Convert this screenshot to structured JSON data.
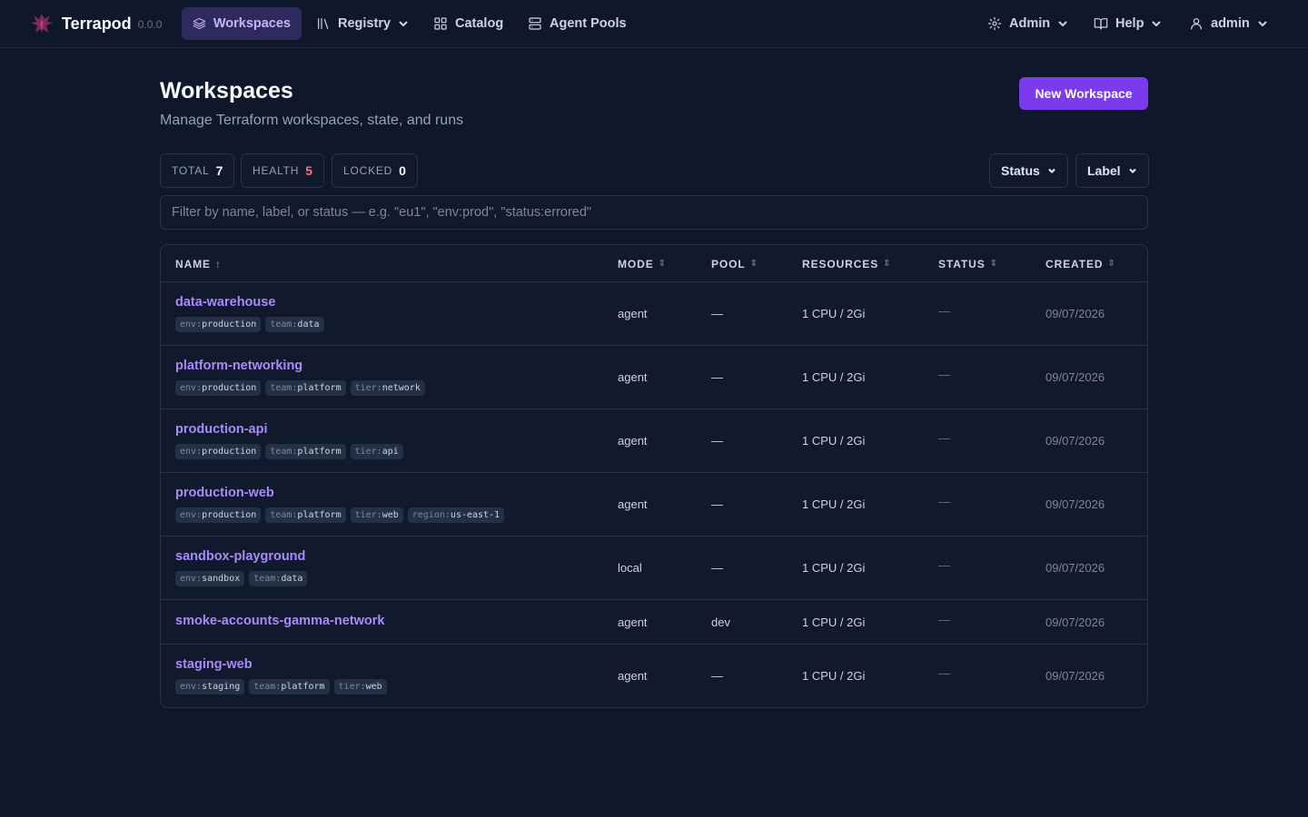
{
  "brand": {
    "name": "Terrapod",
    "version": "0.0.0"
  },
  "nav": {
    "workspaces": "Workspaces",
    "registry": "Registry",
    "catalog": "Catalog",
    "agent_pools": "Agent Pools",
    "admin": "Admin",
    "help": "Help",
    "user": "admin"
  },
  "header": {
    "title": "Workspaces",
    "subtitle": "Manage Terraform workspaces, state, and runs",
    "new_button": "New Workspace"
  },
  "stats": {
    "total_label": "TOTAL",
    "total_value": "7",
    "health_label": "HEALTH",
    "health_value": "5",
    "locked_label": "LOCKED",
    "locked_value": "0"
  },
  "filters": {
    "status": "Status",
    "label": "Label"
  },
  "search": {
    "placeholder": "Filter by name, label, or status — e.g. \"eu1\", \"env:prod\", \"status:errored\""
  },
  "table": {
    "columns": {
      "name": "NAME",
      "mode": "MODE",
      "pool": "POOL",
      "resources": "RESOURCES",
      "status": "STATUS",
      "created": "CREATED"
    },
    "rows": [
      {
        "name": "data-warehouse",
        "mode": "agent",
        "pool": "—",
        "resources": "1 CPU / 2Gi",
        "status": "—",
        "created": "09/07/2026",
        "labels": [
          {
            "k": "env:",
            "v": "production"
          },
          {
            "k": "team:",
            "v": "data"
          }
        ]
      },
      {
        "name": "platform-networking",
        "mode": "agent",
        "pool": "—",
        "resources": "1 CPU / 2Gi",
        "status": "—",
        "created": "09/07/2026",
        "labels": [
          {
            "k": "env:",
            "v": "production"
          },
          {
            "k": "team:",
            "v": "platform"
          },
          {
            "k": "tier:",
            "v": "network"
          }
        ]
      },
      {
        "name": "production-api",
        "mode": "agent",
        "pool": "—",
        "resources": "1 CPU / 2Gi",
        "status": "—",
        "created": "09/07/2026",
        "labels": [
          {
            "k": "env:",
            "v": "production"
          },
          {
            "k": "team:",
            "v": "platform"
          },
          {
            "k": "tier:",
            "v": "api"
          }
        ]
      },
      {
        "name": "production-web",
        "mode": "agent",
        "pool": "—",
        "resources": "1 CPU / 2Gi",
        "status": "—",
        "created": "09/07/2026",
        "labels": [
          {
            "k": "env:",
            "v": "production"
          },
          {
            "k": "team:",
            "v": "platform"
          },
          {
            "k": "tier:",
            "v": "web"
          },
          {
            "k": "region:",
            "v": "us-east-1"
          }
        ]
      },
      {
        "name": "sandbox-playground",
        "mode": "local",
        "pool": "—",
        "resources": "1 CPU / 2Gi",
        "status": "—",
        "created": "09/07/2026",
        "labels": [
          {
            "k": "env:",
            "v": "sandbox"
          },
          {
            "k": "team:",
            "v": "data"
          }
        ]
      },
      {
        "name": "smoke-accounts-gamma-network",
        "mode": "agent",
        "pool": "dev",
        "resources": "1 CPU / 2Gi",
        "status": "—",
        "created": "09/07/2026",
        "labels": []
      },
      {
        "name": "staging-web",
        "mode": "agent",
        "pool": "—",
        "resources": "1 CPU / 2Gi",
        "status": "—",
        "created": "09/07/2026",
        "labels": [
          {
            "k": "env:",
            "v": "staging"
          },
          {
            "k": "team:",
            "v": "platform"
          },
          {
            "k": "tier:",
            "v": "web"
          }
        ]
      }
    ]
  }
}
